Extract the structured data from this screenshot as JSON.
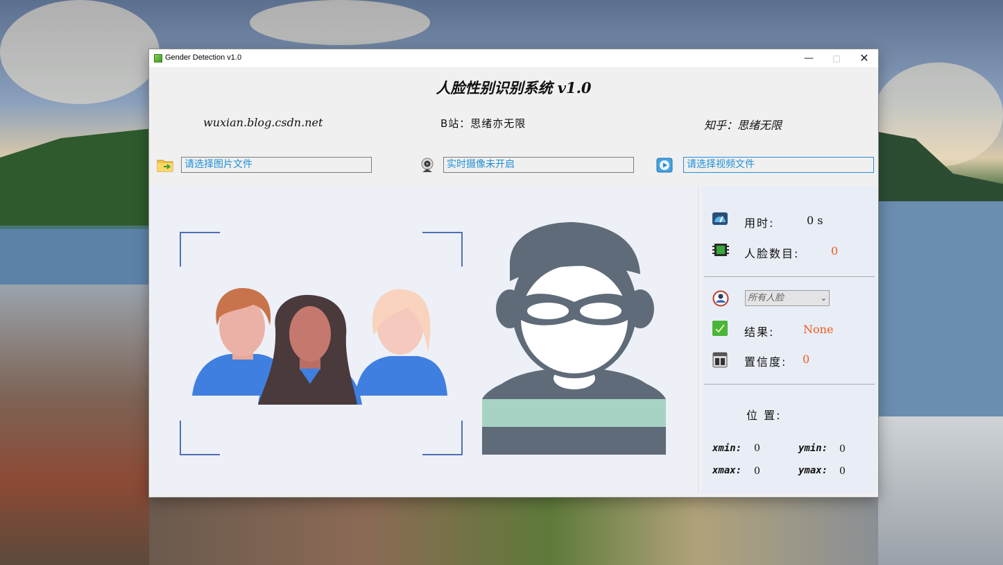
{
  "window": {
    "title": "Gender Detection v1.0",
    "controls": {
      "minimize": "—",
      "maximize": "□",
      "close": "✕"
    }
  },
  "header": {
    "title": "人脸性别识别系统  v1.0",
    "blog": "wuxian.blog.csdn.net",
    "bilibili": "B站：思绪亦无限",
    "zhihu": "知乎：思绪无限"
  },
  "inputs": {
    "image_file": "请选择图片文件",
    "camera": "实时摄像未开启",
    "video_file": "请选择视频文件"
  },
  "stats": {
    "time_label": "用时:",
    "time_value": "0 s",
    "face_count_label": "人脸数目:",
    "face_count_value": "0",
    "face_select": "所有人脸",
    "result_label": "结果:",
    "result_value": "None",
    "confidence_label": "置信度:",
    "confidence_value": "0",
    "position_label": "位 置:",
    "xmin_label": "xmin:",
    "xmin_value": "0",
    "ymin_label": "ymin:",
    "ymin_value": "0",
    "xmax_label": "xmax:",
    "xmax_value": "0",
    "ymax_label": "ymax:",
    "ymax_value": "0"
  },
  "colors": {
    "accent_blue": "#1e8fd8",
    "value_orange": "#f05a1e",
    "frame_blue": "#4e6fb5",
    "avatar_gray": "#5f6b78",
    "avatar_stripe": "#a7d3c4"
  },
  "icons": [
    "folder-icon",
    "webcam-icon",
    "video-play-icon",
    "speedometer-icon",
    "face-chip-icon",
    "target-person-icon",
    "result-check-icon",
    "confidence-calendar-icon"
  ]
}
